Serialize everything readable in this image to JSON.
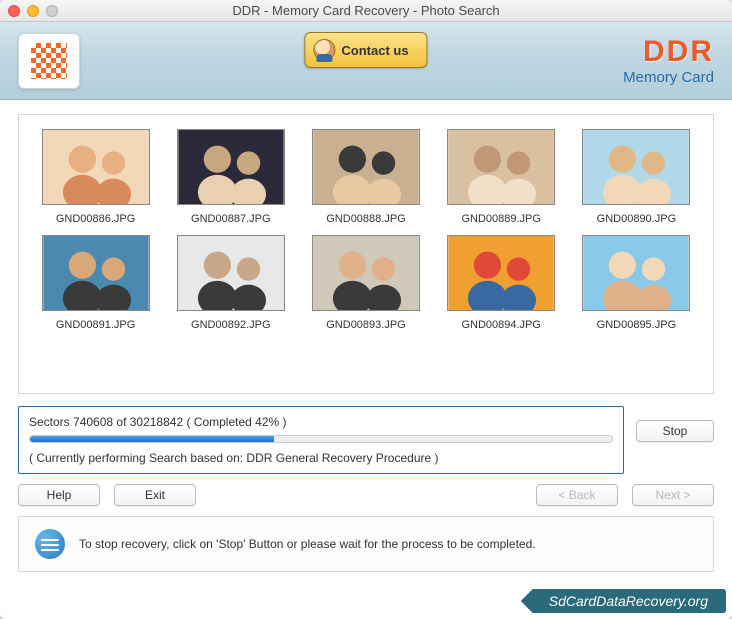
{
  "window": {
    "title": "DDR - Memory Card Recovery - Photo Search"
  },
  "header": {
    "contact_label": "Contact us",
    "brand_main": "DDR",
    "brand_sub": "Memory Card"
  },
  "thumbnails": [
    {
      "filename": "GND00886.JPG"
    },
    {
      "filename": "GND00887.JPG"
    },
    {
      "filename": "GND00888.JPG"
    },
    {
      "filename": "GND00889.JPG"
    },
    {
      "filename": "GND00890.JPG"
    },
    {
      "filename": "GND00891.JPG"
    },
    {
      "filename": "GND00892.JPG"
    },
    {
      "filename": "GND00893.JPG"
    },
    {
      "filename": "GND00894.JPG"
    },
    {
      "filename": "GND00895.JPG"
    }
  ],
  "progress": {
    "sectors_line": "Sectors 740608 of 30218842    ( Completed 42% )",
    "percent": 42,
    "status_line": "( Currently performing Search based on: DDR General Recovery Procedure )"
  },
  "buttons": {
    "stop": "Stop",
    "help": "Help",
    "exit": "Exit",
    "back": "< Back",
    "next": "Next >"
  },
  "info": {
    "text": "To stop recovery, click on 'Stop' Button or please wait for the process to be completed."
  },
  "footer": {
    "site": "SdCardDataRecovery.org"
  }
}
